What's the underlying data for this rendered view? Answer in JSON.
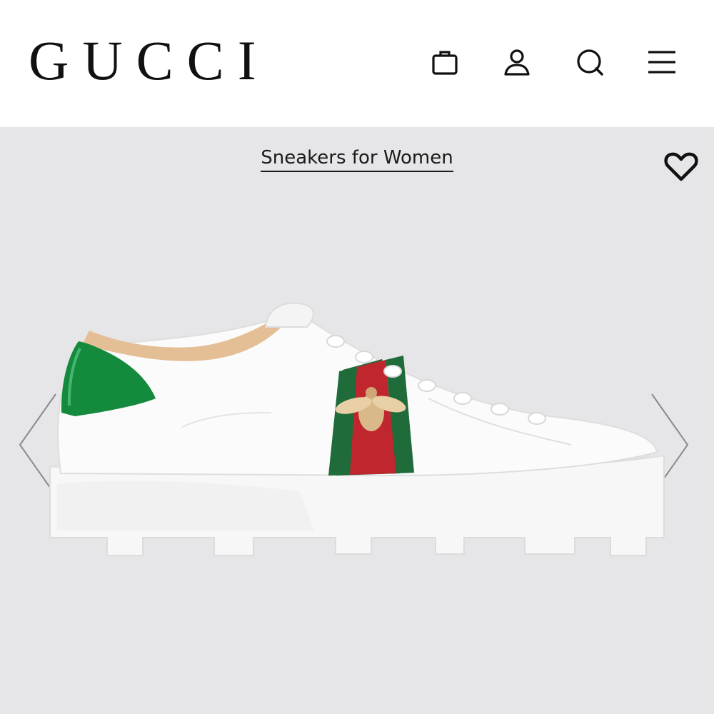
{
  "brand": {
    "logo_text": "GUCCI"
  },
  "header": {
    "icons": [
      "shopping-bag-icon",
      "account-icon",
      "search-icon",
      "menu-icon"
    ]
  },
  "breadcrumb": {
    "label": "Sneakers for Women"
  },
  "product": {
    "stripe_colors": {
      "green": "#1f6b3a",
      "red": "#c0262d"
    },
    "heel_tab_color": "#138a3c"
  },
  "gallery": {
    "prev_icon": "chevron-left-icon",
    "next_icon": "chevron-right-icon"
  },
  "wishlist": {
    "icon": "heart-outline-icon"
  }
}
